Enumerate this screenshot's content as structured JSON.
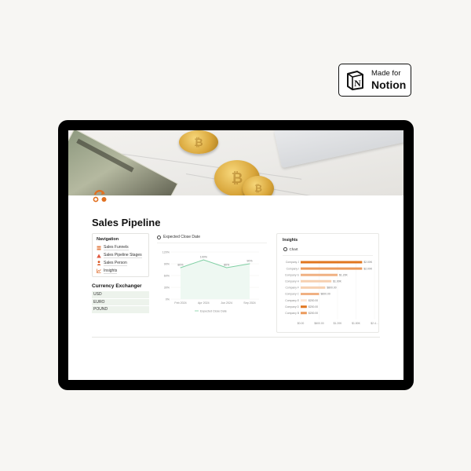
{
  "badge": {
    "line1": "Made for",
    "line2": "Notion"
  },
  "page": {
    "title": "Sales Pipeline"
  },
  "navigation": {
    "title": "Navigation",
    "items": [
      {
        "label": "Sales Funnels",
        "icon": "funnel-icon",
        "color": "#e1793f"
      },
      {
        "label": "Sales Pipeline Stages",
        "icon": "stages-icon",
        "color": "#e1793f"
      },
      {
        "label": "Sales Person",
        "icon": "person-icon",
        "color": "#d9541e"
      },
      {
        "label": "Insights",
        "icon": "chart-icon",
        "color": "#e1793f"
      }
    ]
  },
  "currency": {
    "title": "Currency Exchanger",
    "rows": [
      "USD",
      "EURO",
      "POUND"
    ]
  },
  "line_chart": {
    "header": "Expected Close Date",
    "legend": "Expected Close Date",
    "color": "#7fcfa3"
  },
  "insights": {
    "title": "Insights",
    "tab": "Chart",
    "accent": "#e1793f"
  },
  "chart_data": [
    {
      "type": "area",
      "title": "Expected Close Date",
      "x": [
        "Feb 2024",
        "Apr 2024",
        "Jun 2024",
        "Sep 2024"
      ],
      "series": [
        {
          "name": "Expected Close Date",
          "values": [
            80,
            100,
            80,
            90
          ],
          "labels": [
            "80%",
            "100%",
            "80%",
            "90%"
          ]
        }
      ],
      "yticks": [
        "0%",
        "30%",
        "60%",
        "90%",
        "120%"
      ],
      "ylim": [
        0,
        120
      ],
      "grid": true,
      "legend": "bottom"
    },
    {
      "type": "bar",
      "orientation": "horizontal",
      "title": "Chart",
      "categories": [
        "Company J",
        "Company I",
        "Company G",
        "Company H",
        "Company F",
        "Company C",
        "Company E",
        "Company D",
        "Company B"
      ],
      "values": [
        2000,
        2000,
        1200,
        1000,
        800,
        600,
        200,
        200,
        200
      ],
      "labels": [
        "$2.00K",
        "$2.00K",
        "$1.20K",
        "$1.00K",
        "$800.00",
        "$600.00",
        "$200.00",
        "$200.00",
        "$200.00"
      ],
      "colors": [
        "#e1761f",
        "#eb9a5c",
        "#f0b183",
        "#f6d0b0",
        "#f6d0b0",
        "#f0b183",
        "#fbe6d6",
        "#e1761f",
        "#eb9a5c"
      ],
      "xticks": [
        "$0.00",
        "$600.00",
        "$1.20K",
        "$1.80K",
        "$2.4..."
      ],
      "xlim": [
        0,
        2400
      ],
      "grid": true
    }
  ]
}
